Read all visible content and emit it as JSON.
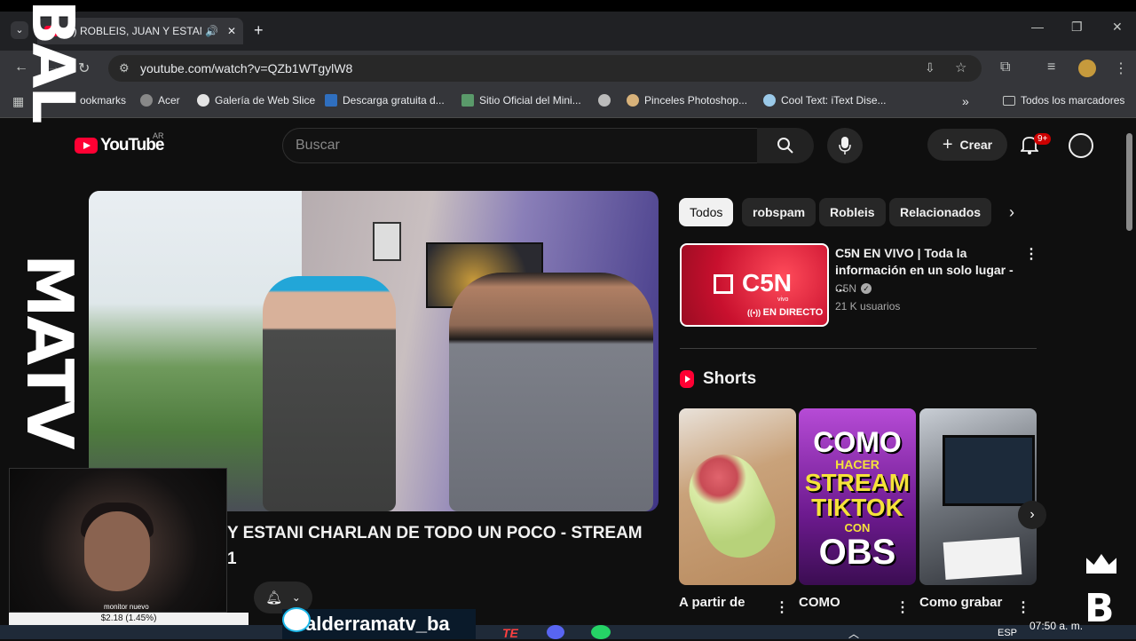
{
  "browser": {
    "tab_title": "(3) ROBLEIS, JUAN Y ESTANI",
    "url": "youtube.com/watch?v=QZb1WTgylW8",
    "bookmarks": [
      {
        "label": "ookmarks"
      },
      {
        "label": "Acer"
      },
      {
        "label": "Galería de Web Slice"
      },
      {
        "label": "Descarga gratuita d..."
      },
      {
        "label": "Sitio Oficial del Mini..."
      },
      {
        "label": "Pinceles Photoshop..."
      },
      {
        "label": "Cool Text: iText Dise..."
      }
    ],
    "all_bookmarks": "Todos los marcadores",
    "more_bookmarks": "»"
  },
  "youtube": {
    "logo_text": "YouTube",
    "country": "AR",
    "search_placeholder": "Buscar",
    "create_label": "Crear",
    "notif_badge": "9+"
  },
  "video": {
    "title_line1": "Y ESTANI CHARLAN DE TODO UN POCO - STREAM",
    "title_line2": "1"
  },
  "chips": [
    {
      "label": "Todos",
      "active": true
    },
    {
      "label": "robspam"
    },
    {
      "label": "Robleis"
    },
    {
      "label": "Relacionados"
    }
  ],
  "recommended": {
    "title": "C5N EN VIVO | Toda la información en un solo lugar - ...",
    "channel": "C5N",
    "viewers": "21 K usuarios",
    "thumb_brand": "C5N",
    "thumb_vivo": "vivo",
    "thumb_live": "EN DIRECTO"
  },
  "shorts": {
    "header": "Shorts",
    "items": [
      {
        "title": "A partir de"
      },
      {
        "title": "COMO",
        "thumb_lines": [
          "COMO",
          "HACER",
          "STREAM",
          "TIKTOK",
          "CON",
          "OBS"
        ]
      },
      {
        "title": "Como grabar"
      }
    ]
  },
  "overlay": {
    "vertical_text_top": "BAL",
    "vertical_text_mid": "MATV",
    "monitor_label": "monitor nuevo",
    "price": "$2.18 (1.45%)",
    "banner": "alderramatv_ba",
    "brand_letter": "B"
  },
  "taskbar": {
    "lang": "ESP",
    "time": "07:50 a. m."
  },
  "colors": {
    "youtube_red": "#ff0033",
    "c5n_red": "#c8102e",
    "background": "#0f0f0f"
  }
}
